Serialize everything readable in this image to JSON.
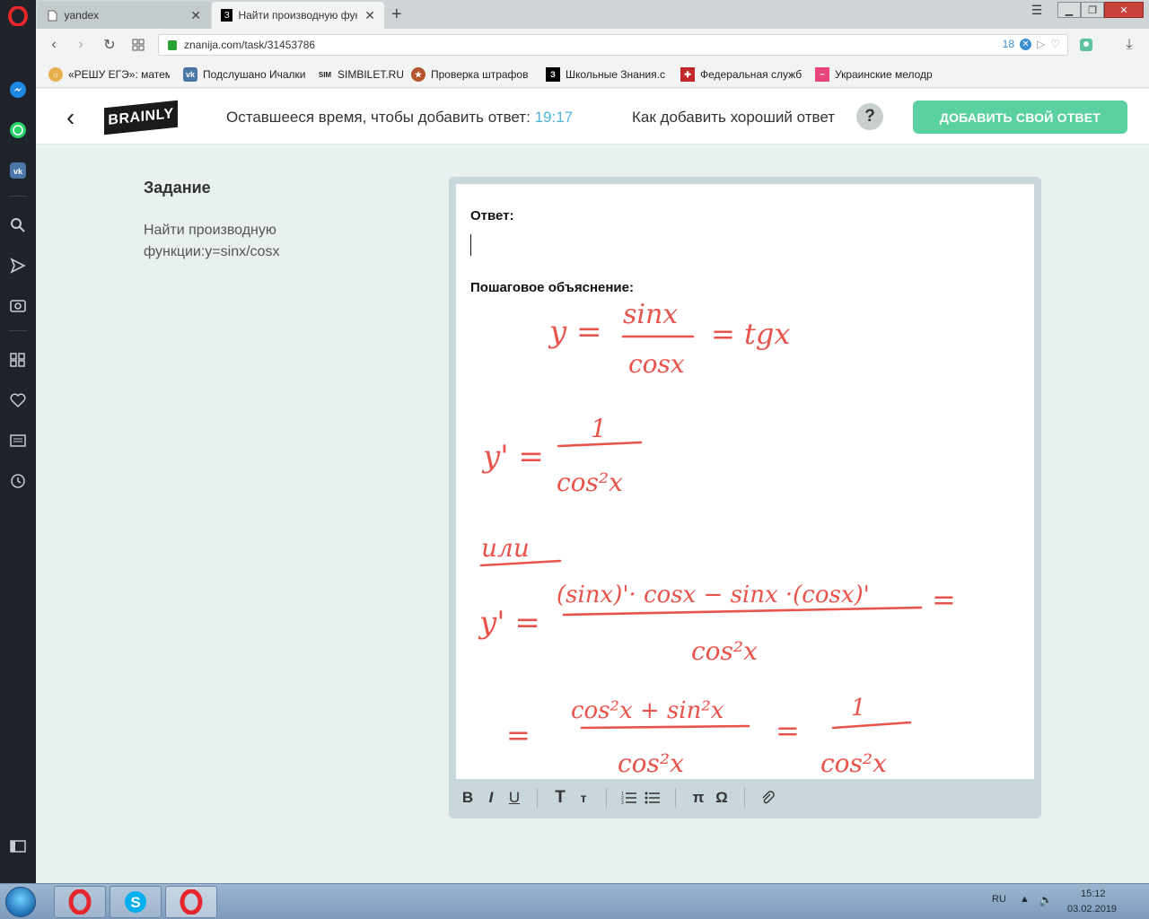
{
  "browser": {
    "tabs": [
      {
        "title": "yandex",
        "active": false
      },
      {
        "title": "Найти производную фун",
        "active": true
      }
    ],
    "url": "znanija.com/task/31453786",
    "adblock_count": "18",
    "bookmarks": [
      {
        "label": "«РЕШУ ЕГЭ»: матема",
        "icon": "reshu-ege-icon"
      },
      {
        "label": "Подслушано Ичалки",
        "icon": "vk-icon"
      },
      {
        "label": "SIMBILET.RU",
        "icon": "sim-icon"
      },
      {
        "label": "Проверка штрафов",
        "icon": "emblem-icon"
      },
      {
        "label": "Школьные Знания.c",
        "icon": "znanija-icon"
      },
      {
        "label": "Федеральная служб",
        "icon": "fns-icon"
      },
      {
        "label": "Украинские мелодр",
        "icon": "ivi-icon"
      }
    ]
  },
  "header": {
    "logo": "BRAINLY",
    "timer_label": "Оставшееся время, чтобы добавить ответ:",
    "timer_value": "19:17",
    "how_to": "Как добавить хороший ответ",
    "help_symbol": "?",
    "add_answer": "ДОБАВИТЬ СВОЙ ОТВЕТ"
  },
  "task": {
    "title": "Задание",
    "text": "Найти производную функции:y=sinx/cosx"
  },
  "editor": {
    "answer_label": "Ответ:",
    "explanation_label": "Пошаговое объяснение:",
    "handwritten_lines": [
      {
        "lhs": "y =",
        "num": "sinx",
        "den": "cosx",
        "rhs": "= tgx"
      },
      {
        "lhs": "y' =",
        "num": "1",
        "den": "cos²x"
      },
      {
        "note": "или"
      },
      {
        "lhs": "y' =",
        "num": "(sinx)'· cosx − sinx ·(cosx)'",
        "den": "cos²x",
        "rhs": "="
      },
      {
        "lhs": "=",
        "num": "cos²x + sin²x",
        "den": "cos²x",
        "mid": "=",
        "num2": "1",
        "den2": "cos²x"
      }
    ],
    "ink_color": "#e8534c",
    "toolbar": {
      "bold": "B",
      "italic": "I",
      "underline": "U",
      "text_large": "T",
      "text_small": "т",
      "pi": "π",
      "omega": "Ω"
    }
  },
  "taskbar": {
    "lang": "RU",
    "time": "15:12",
    "date": "03.02.2019"
  },
  "colors": {
    "accent_green": "#5bd1a1",
    "timer_blue": "#4fb3d9"
  }
}
